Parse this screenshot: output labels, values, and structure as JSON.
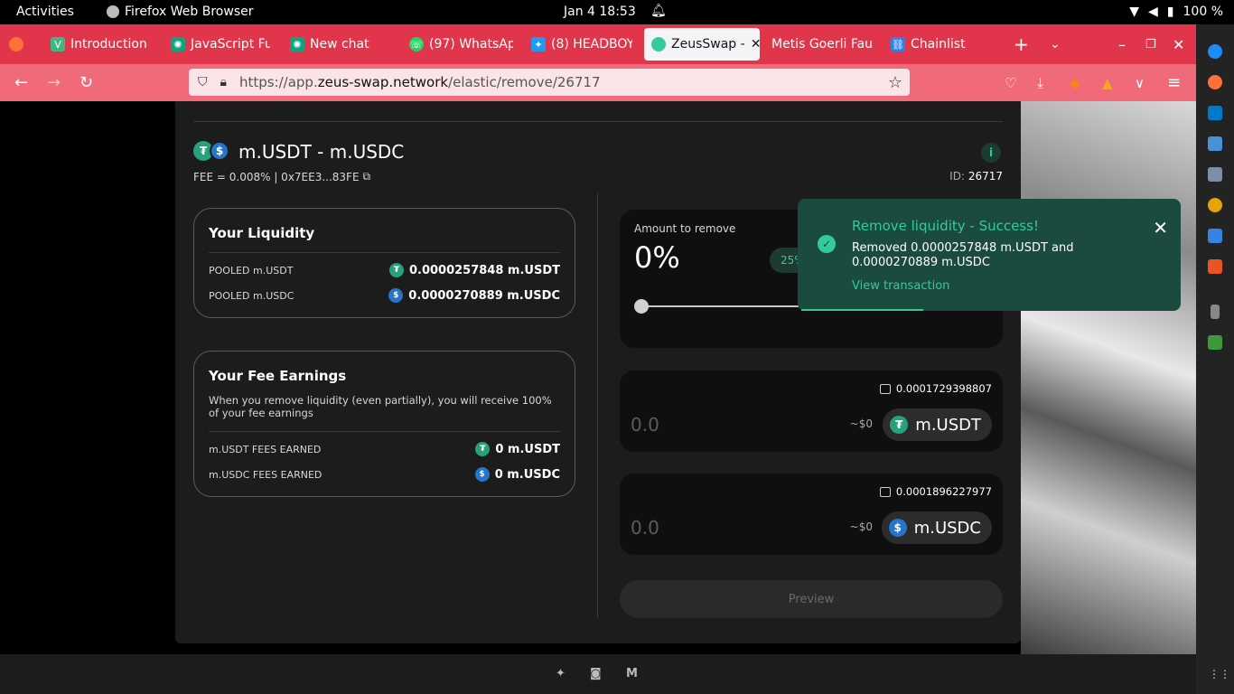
{
  "system_bar": {
    "activities": "Activities",
    "app_name": "Firefox Web Browser",
    "clock": "Jan 4  18:53",
    "battery": "100 %"
  },
  "tabs": [
    {
      "label": "Introduction |",
      "color": "#41b883"
    },
    {
      "label": "JavaScript Fu",
      "color": "#10a37f"
    },
    {
      "label": "New chat",
      "color": "#10a37f"
    },
    {
      "label": "(97) WhatsAp",
      "color": "#25d366"
    },
    {
      "label": "(8) HEADBOY",
      "color": "#1d9bf0"
    },
    {
      "label": "ZeusSwap -",
      "color": "#31cb9e"
    },
    {
      "label": "Metis Goerli Fauc",
      "color": "#00dacc"
    },
    {
      "label": "Chainlist",
      "color": "#2f80ed"
    }
  ],
  "url": {
    "prefix": "https://app.",
    "domain": "zeus-swap.network",
    "path": "/elastic/remove/26717"
  },
  "position": {
    "pair": "m.USDT - m.USDC",
    "fee_line": "FEE = 0.008% | 0x7EE3...83FE",
    "id_label": "ID:",
    "id_value": "26717"
  },
  "liquidity": {
    "title": "Your Liquidity",
    "rows": [
      {
        "label": "POOLED m.USDT",
        "value": "0.0000257848 m.USDT"
      },
      {
        "label": "POOLED m.USDC",
        "value": "0.0000270889 m.USDC"
      }
    ]
  },
  "fees": {
    "title": "Your Fee Earnings",
    "description": "When you remove liquidity (even partially), you will receive 100% of your fee earnings",
    "rows": [
      {
        "label": "m.USDT FEES EARNED",
        "value": "0 m.USDT"
      },
      {
        "label": "m.USDC FEES EARNED",
        "value": "0 m.USDC"
      }
    ]
  },
  "remove": {
    "amount_label": "Amount to remove",
    "percent": "0%",
    "quick_pct": "25%",
    "slider_value": 0
  },
  "outputs": [
    {
      "balance": "0.0001729398807",
      "amount": "0.0",
      "usd": "~$0",
      "token": "m.USDT"
    },
    {
      "balance": "0.0001896227977",
      "amount": "0.0",
      "usd": "~$0",
      "token": "m.USDC"
    }
  ],
  "preview_label": "Preview",
  "toast": {
    "title": "Remove liquidity - Success!",
    "message": "Removed 0.0000257848 m.USDT and 0.0000270889 m.USDC",
    "link": "View transaction"
  },
  "colors": {
    "accent": "#31cb9e",
    "tabbar": "#e0354a",
    "navbar": "#f06a7a",
    "card": "#1c1c1c"
  }
}
